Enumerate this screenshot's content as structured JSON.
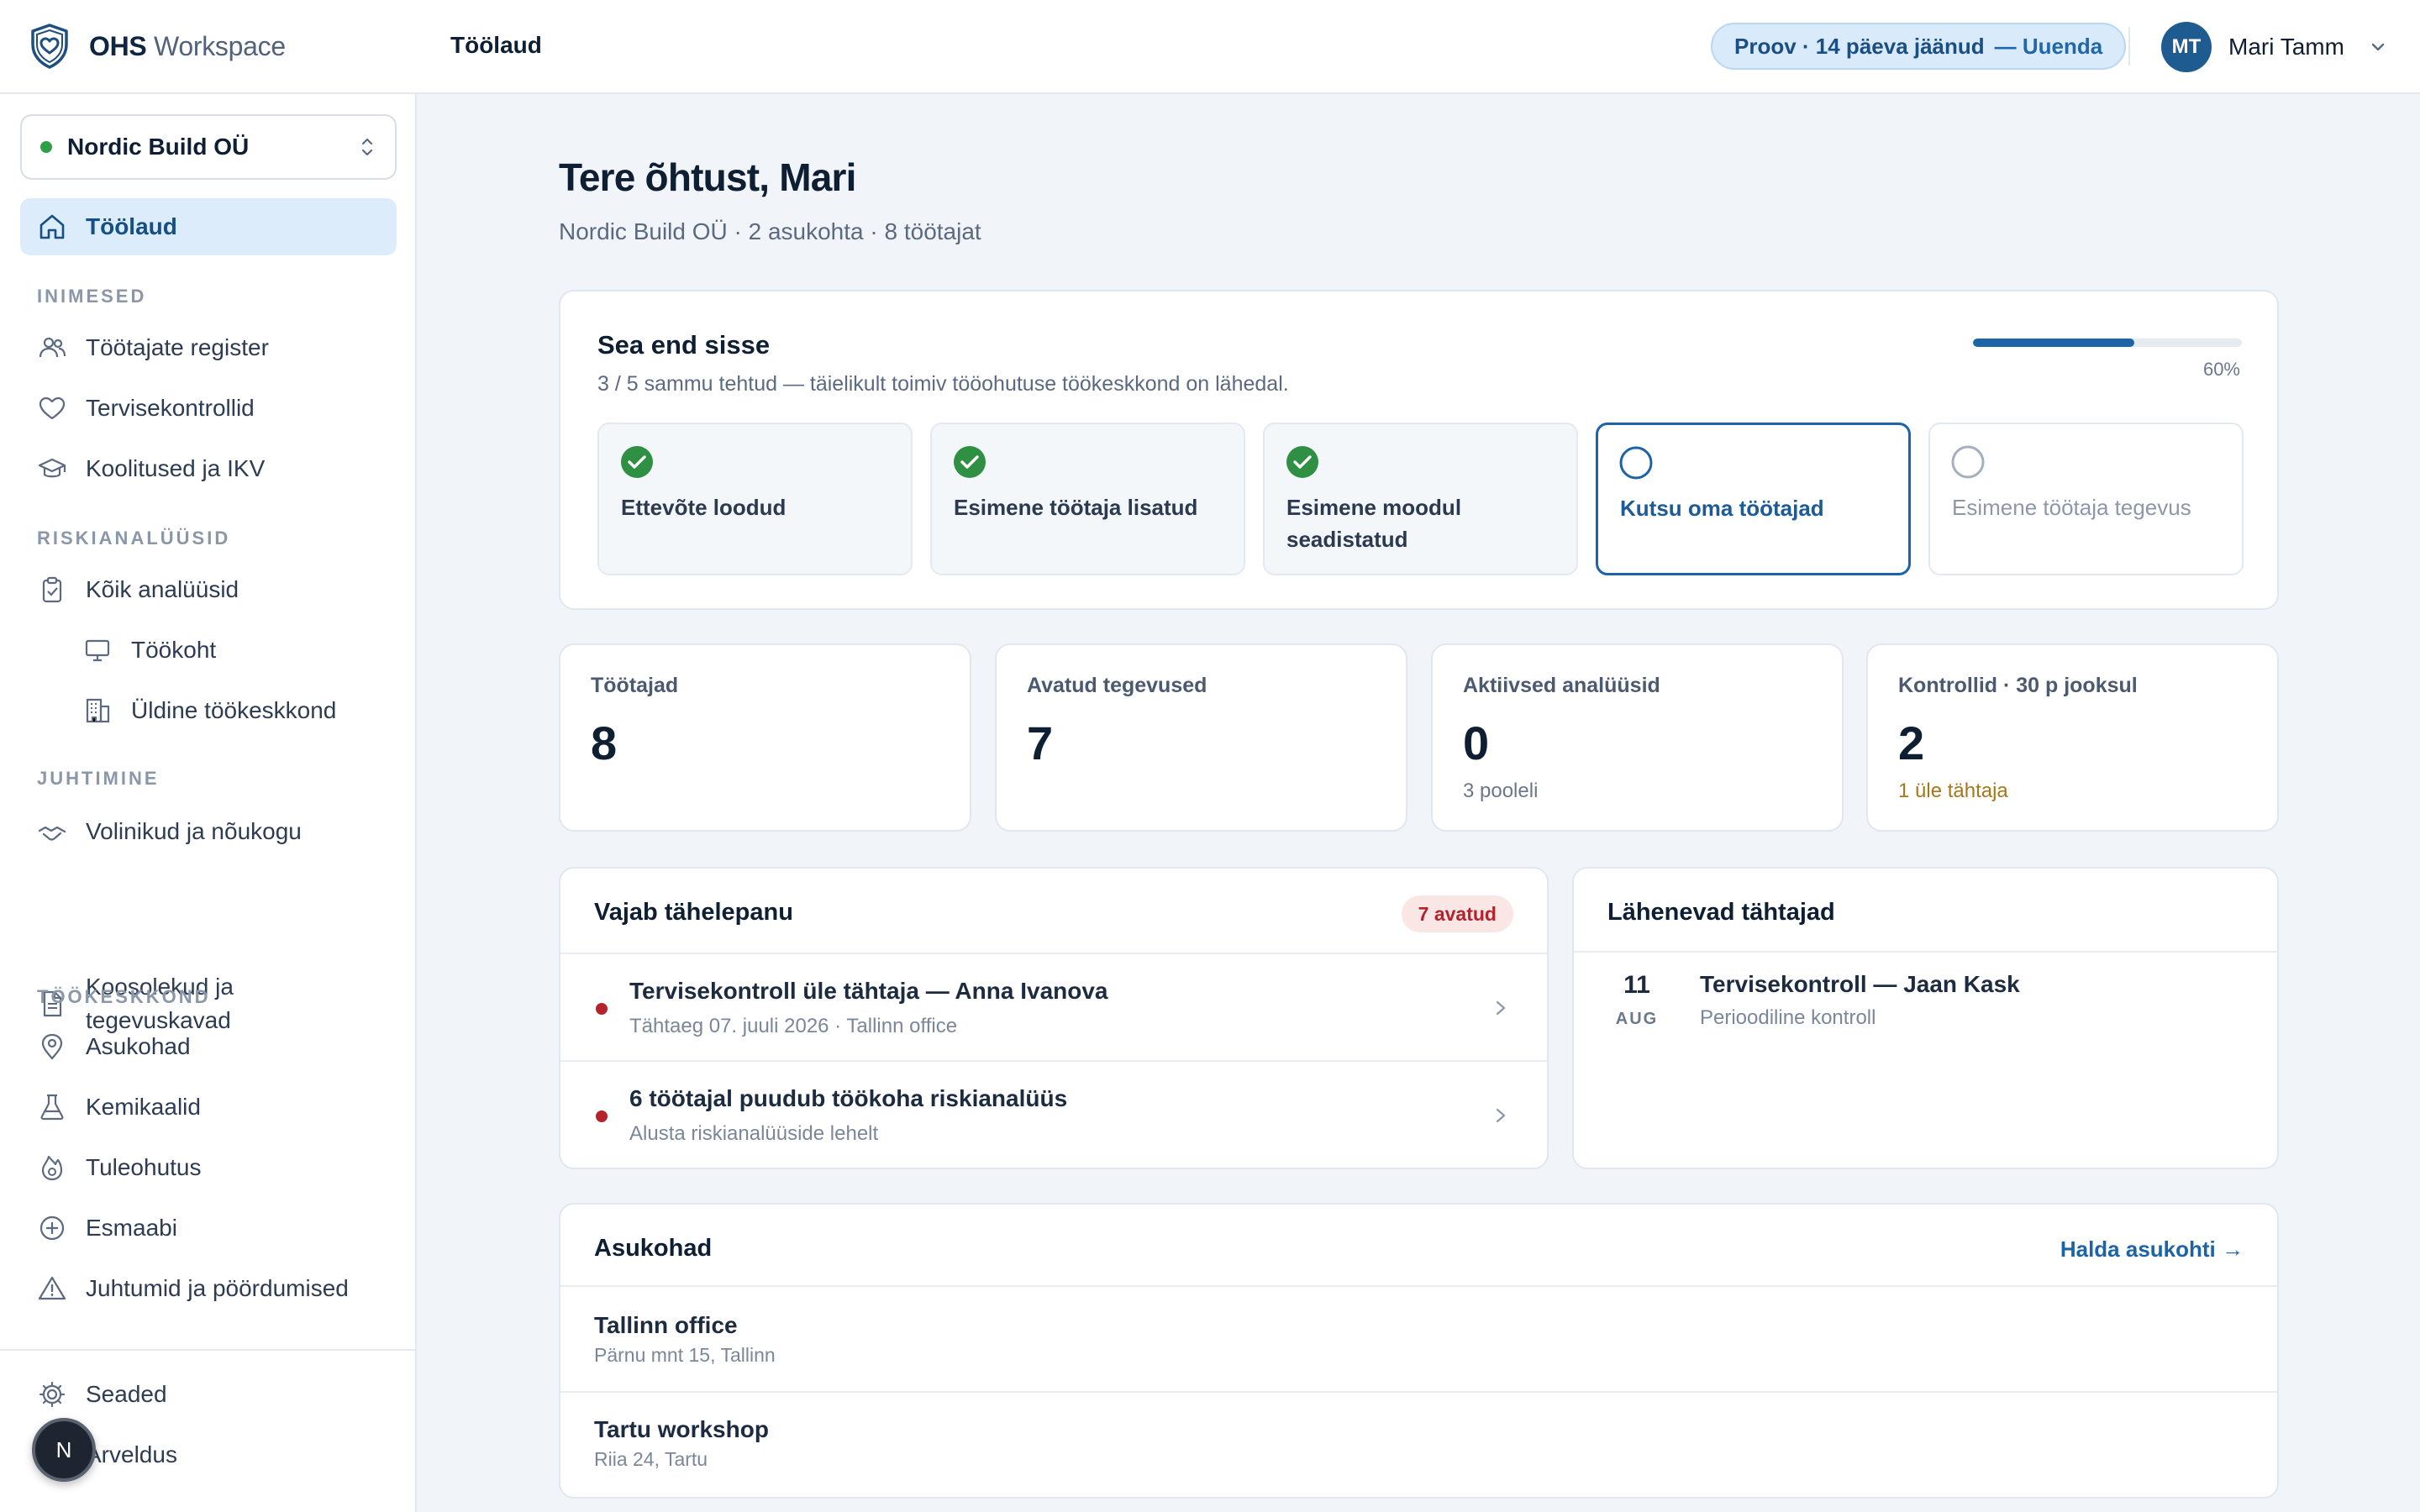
{
  "brand": {
    "name_bold": "OHS",
    "name_light": "Workspace"
  },
  "topbar": {
    "title": "Töölaud",
    "trial_text": "Proov · 14 päeva jäänud",
    "trial_link": "— Uuenda",
    "user_initials": "MT",
    "user_name": "Mari Tamm"
  },
  "sidebar": {
    "org_name": "Nordic Build OÜ",
    "dashboard": "Töölaud",
    "sections": {
      "people": "INIMESED",
      "risk": "RISKIANALÜÜSID",
      "management": "JUHTIMINE",
      "environment": "TÖÖKESKKOND"
    },
    "items": {
      "employees": "Töötajate register",
      "health": "Tervisekontrollid",
      "trainings": "Koolitused ja IKV",
      "all_analyses": "Kõik analüüsid",
      "workplace": "Töökoht",
      "general_env": "Üldine töökeskkond",
      "representatives": "Volinikud ja nõukogu",
      "meetings": "Koosolekud ja tegevuskavad",
      "locations": "Asukohad",
      "chemicals": "Kemikaalid",
      "fire": "Tuleohutus",
      "first_aid": "Esmaabi",
      "incidents": "Juhtumid ja pöördumised",
      "settings": "Seaded",
      "billing": "Arveldus"
    },
    "fab_label": "N"
  },
  "main": {
    "greeting": "Tere õhtust, Mari",
    "subtitle": "Nordic Build OÜ · 2 asukohta · 8 töötajat",
    "onboarding": {
      "title": "Sea end sisse",
      "subtitle": "3 / 5 sammu tehtud — täielikult toimiv tööohutuse töökeskkond on lähedal.",
      "progress": 0.6,
      "progress_label": "60%",
      "steps": [
        {
          "label": "Ettevõte loodud",
          "state": "done"
        },
        {
          "label": "Esimene töötaja lisatud",
          "state": "done"
        },
        {
          "label": "Esimene moodul seadistatud",
          "state": "done"
        },
        {
          "label": "Kutsu oma töötajad",
          "state": "current"
        },
        {
          "label": "Esimene töötaja tegevus",
          "state": "pending"
        }
      ]
    },
    "stats": [
      {
        "label": "Töötajad",
        "value": "8",
        "note": ""
      },
      {
        "label": "Avatud tegevused",
        "value": "7",
        "note": ""
      },
      {
        "label": "Aktiivsed analüüsid",
        "value": "0",
        "note": "3 pooleli"
      },
      {
        "label": "Kontrollid · 30 p jooksul",
        "value": "2",
        "note": "1 üle tähtaja"
      }
    ],
    "attention": {
      "title": "Vajab tähelepanu",
      "badge": "7 avatud",
      "rows": [
        {
          "title": "Tervisekontroll üle tähtaja — Anna Ivanova",
          "sub": "Tähtaeg 07. juuli 2026 · Tallinn office"
        },
        {
          "title": "6 töötajal puudub töökoha riskianalüüs",
          "sub": "Alusta riskianalüüside lehelt"
        }
      ]
    },
    "deadlines": {
      "title": "Lähenevad tähtajad",
      "items": [
        {
          "day": "11",
          "month": "AUG",
          "title": "Tervisekontroll — Jaan Kask",
          "sub": "Perioodiline kontroll"
        }
      ]
    },
    "locations": {
      "title": "Asukohad",
      "manage_link": "Halda asukohti →",
      "items": [
        {
          "name": "Tallinn office",
          "address": "Pärnu mnt 15, Tallinn"
        },
        {
          "name": "Tartu workshop",
          "address": "Riia 24, Tartu"
        }
      ]
    }
  },
  "colors": {
    "accent": "#1d63a8",
    "success": "#2f9e44",
    "danger": "#b4232b",
    "warning": "#a8761a"
  }
}
